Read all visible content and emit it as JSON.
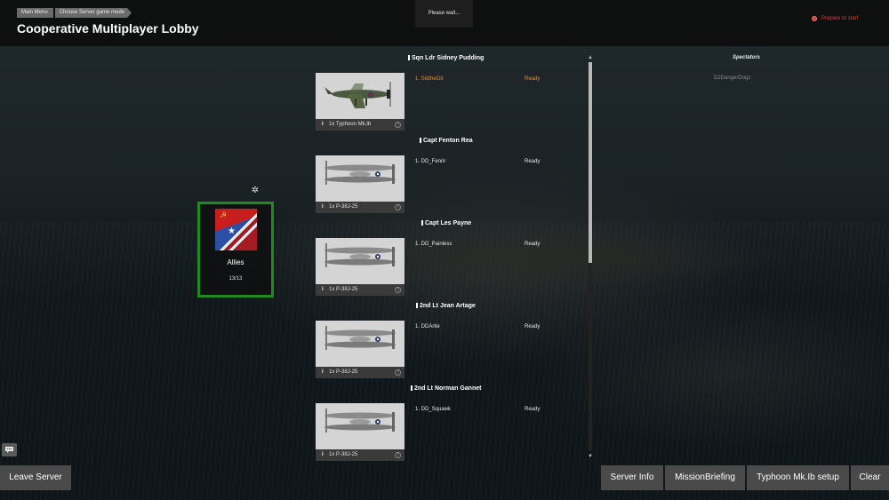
{
  "breadcrumb": [
    "Main Menu",
    "Choose Server game mode"
  ],
  "page_title": "Cooperative Multiplayer Lobby",
  "status": {
    "wait_text": "Please wait...",
    "prepare_text": "Prepare to start",
    "prepare_color": "#e23a3a"
  },
  "team": {
    "name": "Allies",
    "count": "13/13",
    "border_color": "#1f8a1f"
  },
  "slots": [
    {
      "flight": "Sqn Ldr Sidney Pudding",
      "plane_count": "1x",
      "plane": "Typhoon Mk.Ib",
      "player": "1. SidtheGit",
      "status": "Ready",
      "is_self": true,
      "plane_icon": "typhoon-plane-icon"
    },
    {
      "flight": "Capt Fenton Rea",
      "plane_count": "1x",
      "plane": "P-38J-25",
      "player": "1. DD_Fenrir",
      "status": "Ready",
      "is_self": false,
      "plane_icon": "p38-plane-icon"
    },
    {
      "flight": "Capt Les Payne",
      "plane_count": "1x",
      "plane": "P-38J-25",
      "player": "1. DD_Painless",
      "status": "Ready",
      "is_self": false,
      "plane_icon": "p38-plane-icon"
    },
    {
      "flight": "2nd Lt Jean Artage",
      "plane_count": "1x",
      "plane": "P-38J-25",
      "player": "1. DDArtie",
      "status": "Ready",
      "is_self": false,
      "plane_icon": "p38-plane-icon"
    },
    {
      "flight": "2nd Lt Norman Gannet",
      "plane_count": "1x",
      "plane": "P-38J-25",
      "player": "1. DD_Squawk",
      "status": "Ready",
      "is_self": false,
      "plane_icon": "p38-plane-icon"
    }
  ],
  "spectators": {
    "title": "Spectators",
    "names": [
      "D2DangerDogz"
    ]
  },
  "buttons": {
    "leave": "Leave Server",
    "server_info": "Server Info",
    "mission_briefing": "MissionBriefing",
    "plane_setup": "Typhoon Mk.Ib setup",
    "clear": "Clear"
  },
  "colors": {
    "self_highlight": "#f08a2a",
    "ready": "#e8e8e8"
  }
}
